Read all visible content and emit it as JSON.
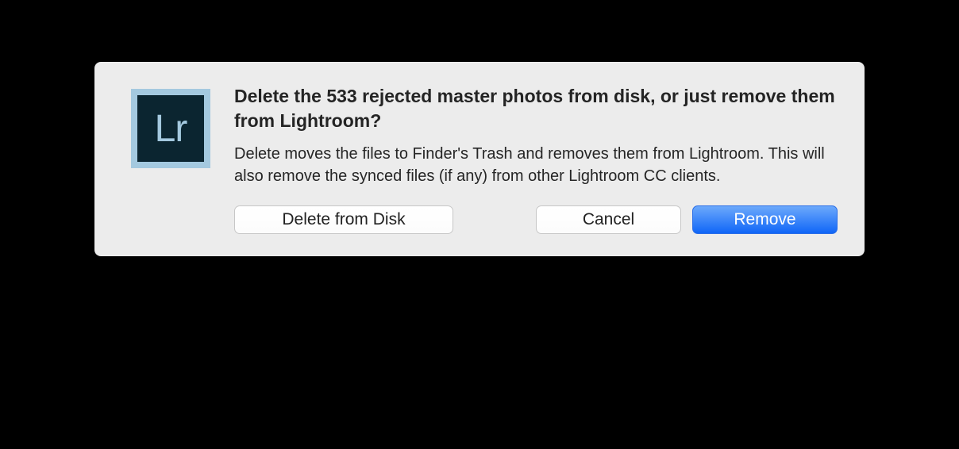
{
  "dialog": {
    "icon_text": "Lr",
    "heading": "Delete the 533 rejected master photos from disk, or just remove them from Lightroom?",
    "body": "Delete moves the files to Finder's Trash and removes them from Lightroom.  This will also remove the synced files (if any) from other Lightroom CC clients.",
    "buttons": {
      "delete_from_disk": "Delete from Disk",
      "cancel": "Cancel",
      "remove": "Remove"
    }
  }
}
